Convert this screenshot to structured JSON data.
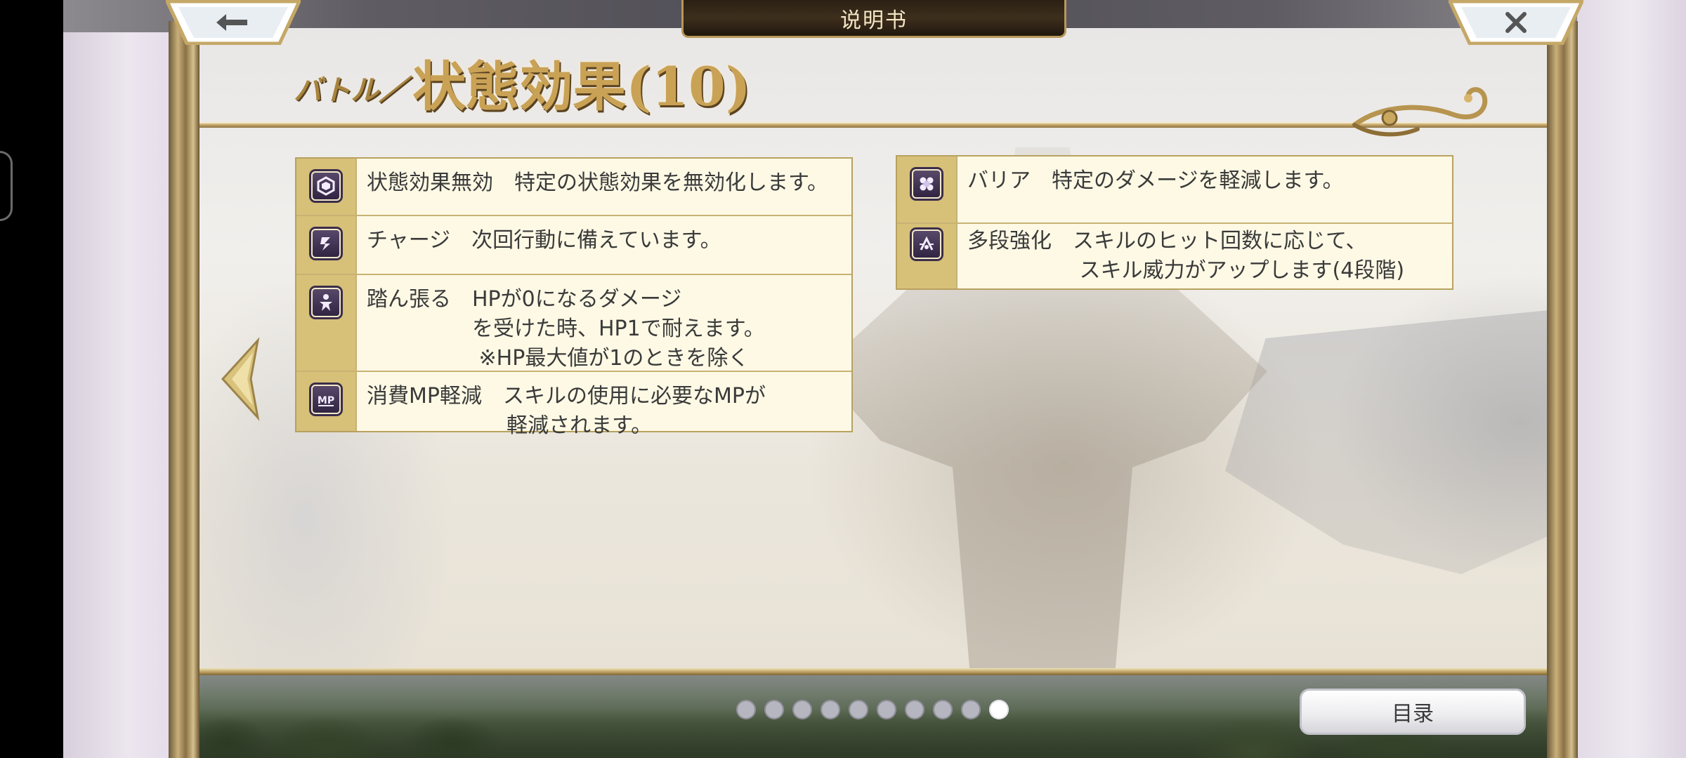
{
  "header": {
    "manual_title": "说明书",
    "title_prefix": "バトル／",
    "title_main": "状態効果(10)"
  },
  "left_table": {
    "rows": [
      {
        "icon": "shield-hexagon-icon",
        "text": "状態効果無効　特定の状態効果を無効化します。"
      },
      {
        "icon": "charge-arrow-icon",
        "text": "チャージ　次回行動に備えています。"
      },
      {
        "icon": "endure-figure-icon",
        "text": "踏ん張る　HPが0になるダメージ\n　　　　　を受けた時、HP1で耐えます。\n　　　　　 ※HP最大値が1のときを除く"
      },
      {
        "icon": "mp-reduction-icon",
        "text": "消費MP軽減　スキルの使用に必要なMPが\n　　　　　　  軽減されます。"
      }
    ]
  },
  "right_table": {
    "rows": [
      {
        "icon": "barrier-icon",
        "text": "バリア　特定のダメージを軽減します。"
      },
      {
        "icon": "multi-hit-boost-icon",
        "text": "多段強化　スキルのヒット回数に応じて、\n　　　　　 スキル威力がアップします(4段階)"
      }
    ]
  },
  "pagination": {
    "total": 10,
    "current": 10
  },
  "footer": {
    "toc_label": "目录"
  }
}
